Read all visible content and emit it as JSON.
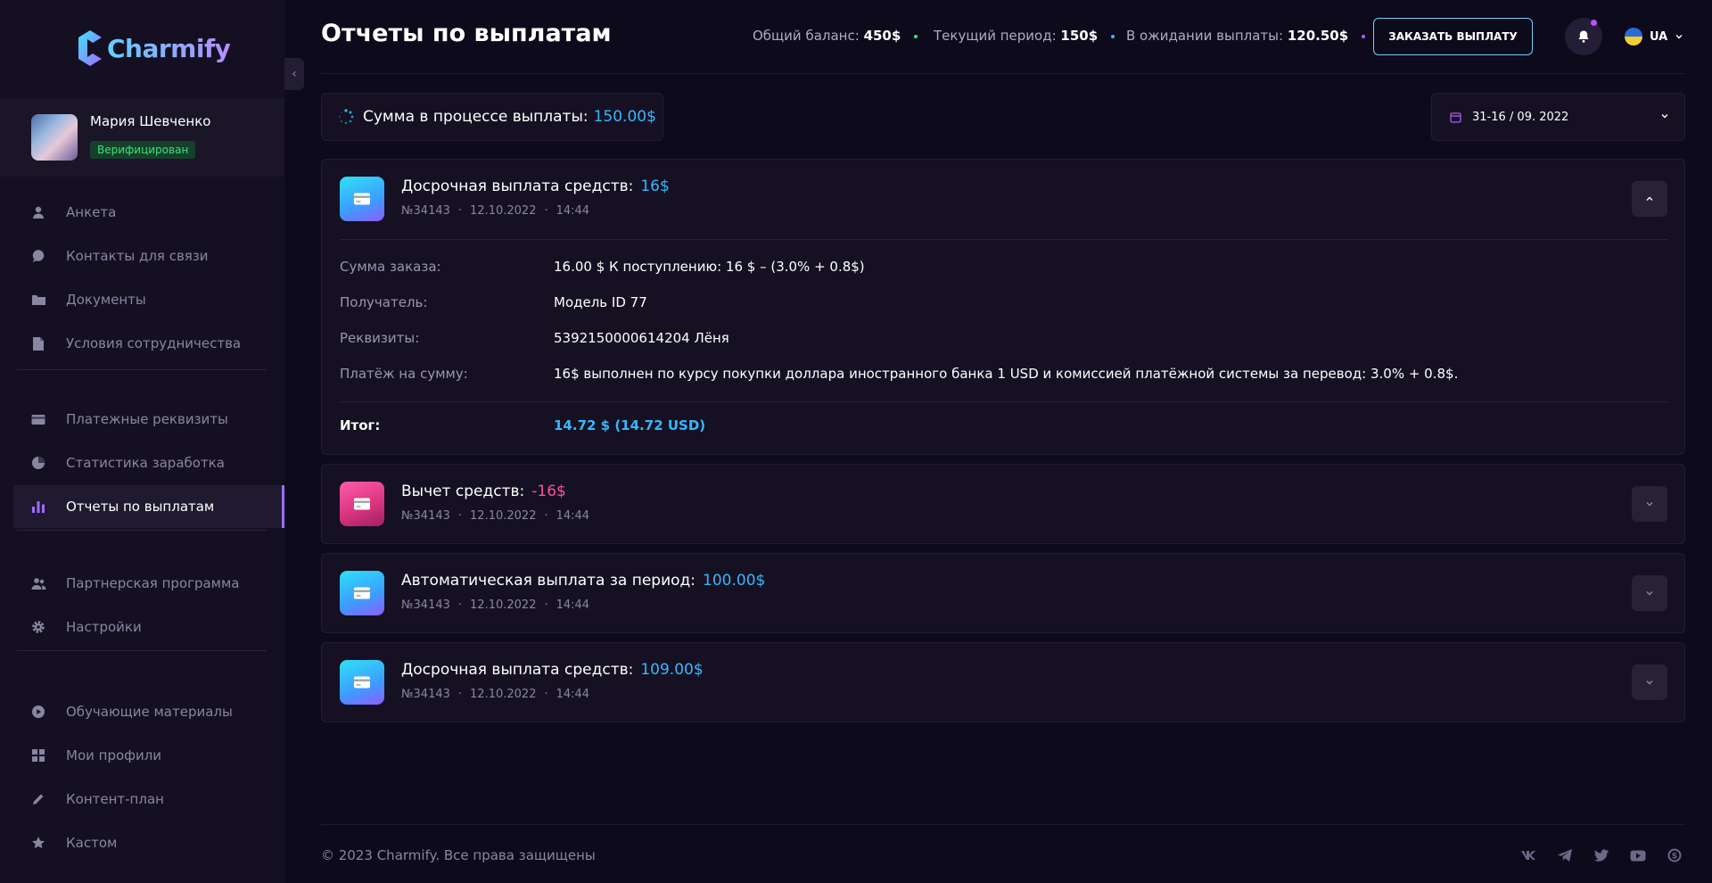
{
  "brand": {
    "name": "Charmify",
    "accent": "#38b6ff",
    "purple": "#a06bff"
  },
  "profile": {
    "name": "Мария Шевченко",
    "status": "Верифицирован"
  },
  "sidebar": {
    "groups": [
      [
        {
          "label": "Анкета",
          "icon": "user-icon"
        },
        {
          "label": "Контакты для связи",
          "icon": "chat-icon"
        },
        {
          "label": "Документы",
          "icon": "folder-icon"
        },
        {
          "label": "Условия сотрудничества",
          "icon": "file-icon"
        }
      ],
      [
        {
          "label": "Платежные реквизиты",
          "icon": "card-icon"
        },
        {
          "label": "Статистика заработка",
          "icon": "pie-chart-icon"
        },
        {
          "label": "Отчеты по выплатам",
          "icon": "bar-chart-icon",
          "active": true
        }
      ],
      [
        {
          "label": "Партнерская программа",
          "icon": "users-icon"
        },
        {
          "label": "Настройки",
          "icon": "gear-icon"
        }
      ],
      [
        {
          "label": "Обучающие материалы",
          "icon": "play-icon"
        },
        {
          "label": "Мои профили",
          "icon": "grid-icon"
        },
        {
          "label": "Контент-план",
          "icon": "pencil-icon"
        },
        {
          "label": "Кастом",
          "icon": "star-icon"
        }
      ]
    ]
  },
  "header": {
    "title": "Отчеты по выплатам",
    "stats": [
      {
        "label": "Общий баланс:",
        "value": "450$",
        "dot": "#3ee07a"
      },
      {
        "label": "Текущий период:",
        "value": "150$",
        "dot": "#38b6ff"
      },
      {
        "label": "В ожидании выплаты:",
        "value": "120.50$",
        "dot": "#b05cff"
      }
    ],
    "order_button": "ЗАКАЗАТЬ ВЫПЛАТУ",
    "language": "UA"
  },
  "summary": {
    "label": "Сумма в процессе выплаты:",
    "amount": "150.00$",
    "date_range": "31-16 / 09. 2022"
  },
  "payouts": [
    {
      "title": "Досрочная выплата средств:",
      "amount": "16$",
      "tone": "blue",
      "number": "№34143",
      "date": "12.10.2022",
      "time": "14:44",
      "expanded": true,
      "details": [
        {
          "label": "Сумма заказа:",
          "value": "16.00 $ К поступлению: 16 $ – (3.0% + 0.8$)"
        },
        {
          "label": "Получатель:",
          "value": "Модель ID 77"
        },
        {
          "label": "Реквизиты:",
          "value": "5392150000614204 Лёня"
        },
        {
          "label": "Платёж на сумму:",
          "value": "16$ выполнен по курсу покупки доллара иностранного банка 1 USD и комиссией платёжной системы за перевод: 3.0% + 0.8$."
        }
      ],
      "total_label": "Итог:",
      "total_value": "14.72 $ (14.72 USD)"
    },
    {
      "title": "Вычет средств:",
      "amount": "-16$",
      "tone": "pink",
      "number": "№34143",
      "date": "12.10.2022",
      "time": "14:44",
      "expanded": false
    },
    {
      "title": "Автоматическая выплата за период:",
      "amount": "100.00$",
      "tone": "blue",
      "number": "№34143",
      "date": "12.10.2022",
      "time": "14:44",
      "expanded": false
    },
    {
      "title": "Досрочная выплата средств:",
      "amount": "109.00$",
      "tone": "blue",
      "number": "№34143",
      "date": "12.10.2022",
      "time": "14:44",
      "expanded": false
    }
  ],
  "footer": {
    "copyright": "© 2023 Charmify. Все права защищены",
    "socials": [
      "vk-icon",
      "telegram-icon",
      "twitter-icon",
      "youtube-icon",
      "skype-icon"
    ]
  }
}
